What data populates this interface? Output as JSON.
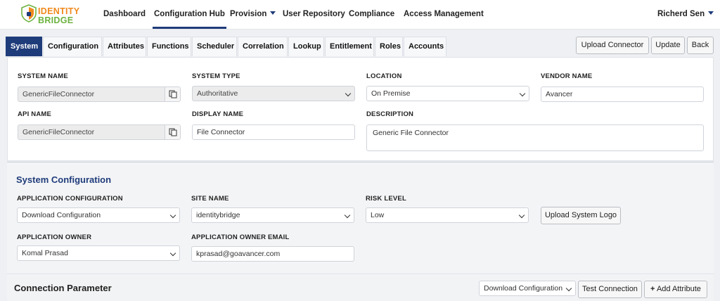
{
  "brand": {
    "line1": "IDENTITY",
    "line2": "BRIDGE"
  },
  "nav": {
    "items": [
      "Dashboard",
      "Configuration Hub",
      "Provision",
      "User Repository",
      "Compliance",
      "Access Management"
    ],
    "user": "Richerd Sen"
  },
  "tabs": [
    "System",
    "Configuration",
    "Attributes",
    "Functions",
    "Scheduler",
    "Correlation",
    "Lookup",
    "Entitlement",
    "Roles",
    "Accounts"
  ],
  "actions": {
    "upload_connector": "Upload Connector",
    "update": "Update",
    "back": "Back"
  },
  "system": {
    "system_name_label": "SYSTEM NAME",
    "system_name": "GenericFileConnector",
    "system_type_label": "SYSTEM TYPE",
    "system_type": "Authoritative",
    "location_label": "LOCATION",
    "location": "On Premise",
    "vendor_name_label": "VENDOR NAME",
    "vendor_name": "Avancer",
    "api_name_label": "API NAME",
    "api_name": "GenericFileConnector",
    "display_name_label": "DISPLAY NAME",
    "display_name": "File Connector",
    "description_label": "DESCRIPTION",
    "description": "Generic File Connector"
  },
  "system_config": {
    "title": "System Configuration",
    "app_config_label": "APPLICATION CONFIGURATION",
    "app_config": "Download Configuration",
    "site_name_label": "SITE NAME",
    "site_name": "identitybridge",
    "risk_level_label": "RISK LEVEL",
    "risk_level": "Low",
    "upload_logo": "Upload System Logo",
    "app_owner_label": "APPLICATION OWNER",
    "app_owner": "Komal Prasad",
    "app_owner_email_label": "APPLICATION OWNER EMAIL",
    "app_owner_email": "kprasad@goavancer.com"
  },
  "connection": {
    "title": "Connection Parameter",
    "config_select": "Download Configuration",
    "test_connection": "Test Connection",
    "add_attribute": "Add Attribute"
  },
  "colors": {
    "accent": "#1f3c7a",
    "brand_orange": "#f08a1c",
    "brand_green": "#6cb33f"
  }
}
